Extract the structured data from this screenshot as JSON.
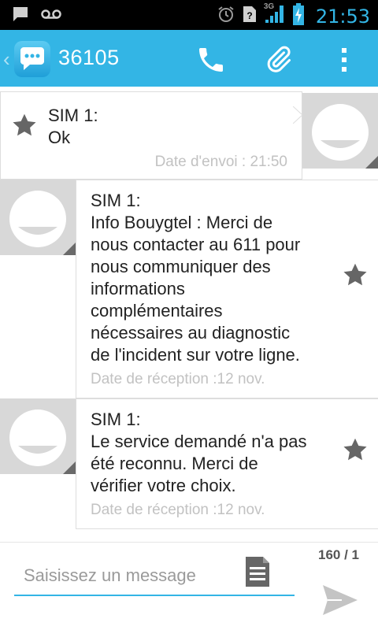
{
  "status_bar": {
    "time": "21:53",
    "network": "3G",
    "icons": [
      "message-notification-icon",
      "voicemail-icon",
      "alarm-icon",
      "no-sim-icon",
      "signal-icon",
      "battery-charging-icon"
    ]
  },
  "action_bar": {
    "title": "36105",
    "actions": [
      "phone-icon",
      "attach-icon",
      "overflow-menu-icon"
    ],
    "accent": "#33b5e5"
  },
  "messages": [
    {
      "direction": "sent",
      "sender": "SIM 1:",
      "body": "Ok",
      "meta": "Date d'envoi : 21:50"
    },
    {
      "direction": "received",
      "sender": "SIM 1:",
      "lines": [
        "Info Bouygtel : Merci de",
        "nous contacter au 611 pour",
        "nous communiquer des",
        "informations",
        "complémentaires",
        "nécessaires au diagnostic",
        "de l'incident sur votre ligne."
      ],
      "meta": "Date de réception :12 nov."
    },
    {
      "direction": "received",
      "sender": "SIM 1:",
      "lines": [
        "Le service demandé n'a pas",
        "été reconnu. Merci de",
        "vérifier votre choix."
      ],
      "meta": "Date de réception :12 nov."
    }
  ],
  "compose": {
    "placeholder": "Saisissez un message",
    "counter": "160 / 1"
  }
}
